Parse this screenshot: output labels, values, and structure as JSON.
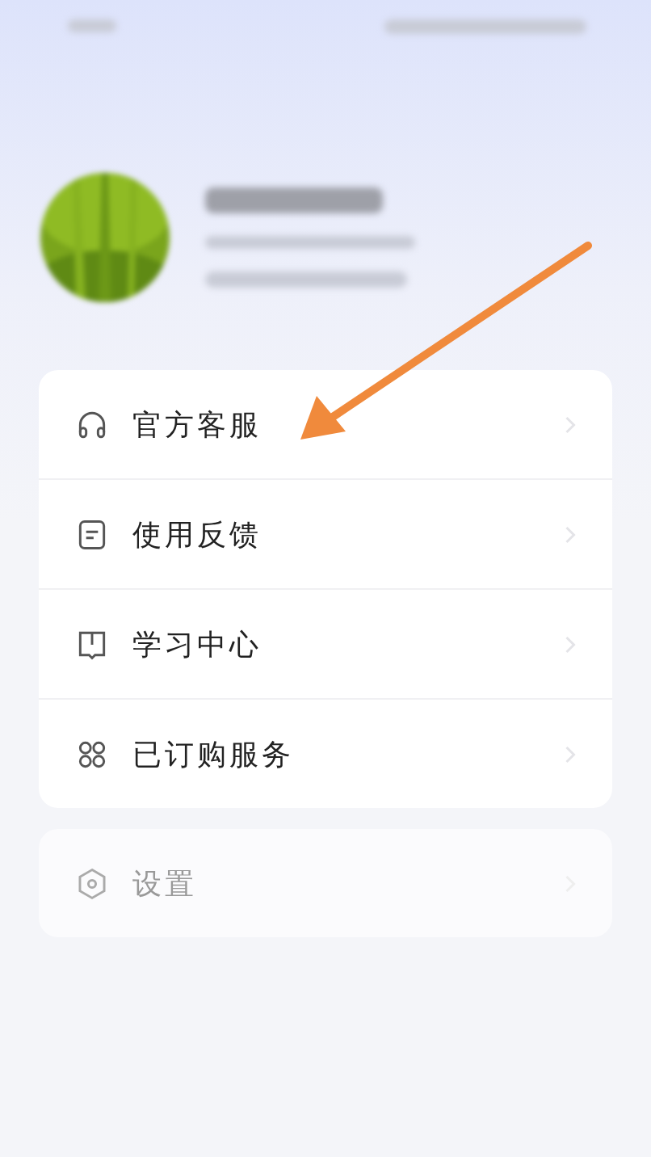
{
  "menu": [
    {
      "kind": "headset",
      "label": "官方客服"
    },
    {
      "kind": "feedback",
      "label": "使用反馈"
    },
    {
      "kind": "book",
      "label": "学习中心"
    },
    {
      "kind": "grid",
      "label": "已订购服务"
    }
  ],
  "settings": {
    "kind": "gear",
    "label": "设置",
    "dimmed": true
  },
  "annotation": {
    "kind": "arrow"
  }
}
